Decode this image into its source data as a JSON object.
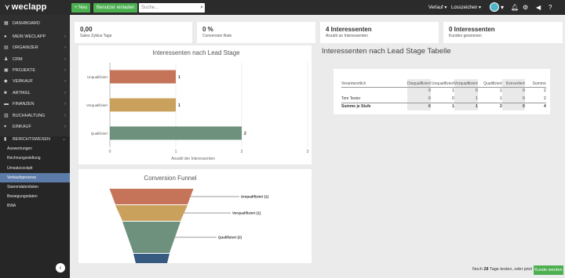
{
  "app": {
    "name": "weclapp"
  },
  "topbar": {
    "new_label": "+ Neu",
    "invite_label": "Benutzer einladen",
    "search_placeholder": "Suche...",
    "menu_verlauf": "Verlauf ▾",
    "menu_lossteichen": "Losszeichen ▾",
    "icons": [
      "bell-icon",
      "gear-icon",
      "megaphone-icon",
      "help-icon"
    ]
  },
  "sidebar": {
    "dashboard": "DASHBOARD",
    "items": [
      "MEIN WECLAPP",
      "ORGANIZER",
      "CRM",
      "PROJEKTE",
      "VERKAUF",
      "ARTIKEL",
      "FINANZEN",
      "BUCHHALTUNG",
      "EINKAUF",
      "BERICHTSWESEN"
    ],
    "subitems": [
      "Auswertungen",
      "Rechnungsstellung",
      "Umsatzcockpit",
      "Verkaufsprozess",
      "Stammdatenlisten",
      "Bewegungsdaten",
      "BWA"
    ],
    "active_subitem": "Verkaufsprozess"
  },
  "kpis": [
    {
      "value": "0,00",
      "label": "Sales Zyklus Tage"
    },
    {
      "value": "0 %",
      "label": "Conversion Rate"
    },
    {
      "value": "4 Interessenten",
      "label": "Anzahl an Interessenten"
    },
    {
      "value": "0 Interessenten",
      "label": "Kunden gewonnen"
    }
  ],
  "chart_data": [
    {
      "type": "bar",
      "orientation": "horizontal",
      "title": "Interessenten nach Lead Stage",
      "categories": [
        "Unqualifiziert",
        "Vorqualifiziert",
        "Qualifiziert"
      ],
      "values": [
        1,
        1,
        2
      ],
      "data_labels": [
        "1",
        "1",
        "2"
      ],
      "colors": [
        "#c5745a",
        "#c9a05c",
        "#6e917d"
      ],
      "xlabel": "Anzahl der Interessenten",
      "xlim": [
        0,
        3
      ],
      "xticks": [
        "0",
        "1",
        "2",
        "3"
      ]
    },
    {
      "type": "funnel",
      "title": "Conversion Funnel",
      "stages": [
        "Unqualifiziert (1)",
        "Vorqualifiziert (1)",
        "Qualifiziert (2)",
        ""
      ],
      "colors": [
        "#c5745a",
        "#c9a05c",
        "#6e917d",
        "#375a80"
      ]
    }
  ],
  "table": {
    "title": "Interessenten nach Lead Stage Tabelle",
    "headers": [
      "Verantwortlich",
      "Disqualifiziert",
      "Unqualifiziert",
      "Vorqualifiziert",
      "Qualifiziert",
      "Konvertiert",
      "Summe"
    ],
    "rows": [
      [
        "",
        "0",
        "1",
        "0",
        "1",
        "0",
        "2"
      ],
      [
        "Tom Tester",
        "0",
        "0",
        "1",
        "1",
        "0",
        "2"
      ],
      [
        "Summe je Stufe",
        "0",
        "1",
        "1",
        "2",
        "0",
        "4"
      ]
    ]
  },
  "footer": {
    "trial_pre": "Noch",
    "trial_days": "28",
    "trial_post": "Tage testen, oder jetzt",
    "cta": "Kunde werden"
  }
}
